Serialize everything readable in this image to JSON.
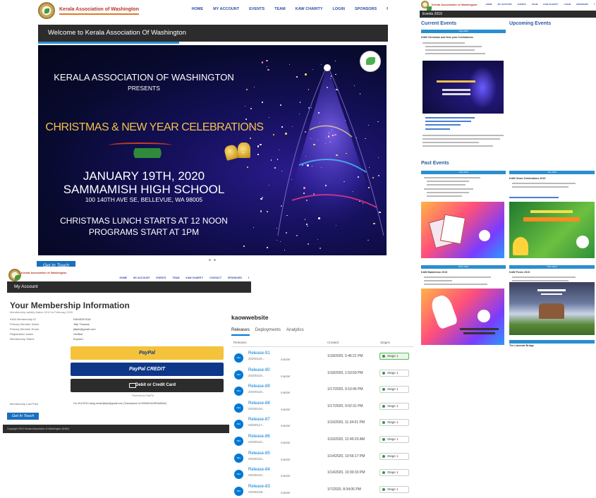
{
  "home": {
    "org_title": "Kerala Association of Washington",
    "menu": [
      "HOME",
      "MY ACCOUNT",
      "EVENTS",
      "TEAM",
      "KAW CHARITY",
      "LOGIN",
      "SPONSORS",
      "f"
    ],
    "welcome": "Welcome to Kerala Association Of Washington",
    "poster": {
      "line1": "KERALA ASSOCIATION OF WASHINGTON",
      "line2": "PRESENTS",
      "line3": "CHRISTMAS & NEW YEAR CELEBRATIONS",
      "line4": "JANUARY 19TH, 2020",
      "line5": "SAMMAMISH HIGH SCHOOL",
      "line6": "100 140TH AVE SE, BELLEVUE, WA 98005",
      "line7": "CHRISTMAS LUNCH STARTS AT 12 NOON",
      "line8": "PROGRAMS START AT 1PM"
    }
  },
  "events": {
    "bar": "Events 2019",
    "current": "Current Events",
    "upcoming": "Upcoming Events",
    "past": "Past Events",
    "current_card": {
      "head": "JAN 2020",
      "title": "KAW Christmas and New year Celebrations"
    },
    "past_cards": [
      {
        "head": "JUN 2019",
        "title": ""
      },
      {
        "head": "JUL 2019",
        "title": "KAW Onam Celebrations 2019"
      },
      {
        "head": "NOV 2019",
        "title": "KAW Badminton 2019"
      },
      {
        "head": "NOV 2019",
        "title": "KAW Picnic 2019"
      }
    ],
    "last_title": "The Lakeside Bridge"
  },
  "account": {
    "get_in_touch": "Get In Touch",
    "menu": [
      "HOME",
      "MY ACCOUNT",
      "EVENTS",
      "TEAM",
      "KAW CHARITY",
      "CONTACT",
      "SPONSORS",
      "f"
    ],
    "bar": "My Account",
    "heading": "Your Membership Information",
    "validity": "Membership validity March 2019 to February 2020",
    "rows": [
      {
        "label": "KAW Membership ID",
        "value": "K8H4D9Y618"
      },
      {
        "label": "Primary Member Name",
        "value": "Jitty Thomas"
      },
      {
        "label": "Primary Member Email",
        "value": "jittyte@gmail.com"
      },
      {
        "label": "Registration status",
        "value": "Verified"
      },
      {
        "label": "Membership Status",
        "value": "Expired"
      }
    ],
    "paypal": "PayPal",
    "paypal_credit": "PayPal CREDIT",
    "debit_card": "Debit or Credit Card",
    "powered": "Powered by PayPal",
    "last_paid_label": "Membership Last Paid",
    "last_paid_value": "On 3/11/2019 using email jittyte@gmail.com (Transaction Id 2HK8910G8P4A89AX)",
    "footer": "Copyright 2019 Kerala Association of Washington (KAW)"
  },
  "releases": {
    "title": "kaowwebsite",
    "tabs": [
      "Releases",
      "Deployments",
      "Analytics"
    ],
    "cols": [
      "Releases",
      "Created",
      "Stages"
    ],
    "items": [
      {
        "name": "Release-91",
        "build": "20200119...",
        "branch": "master",
        "date": "1/18/2020, 5:46:21 PM",
        "stage": "Stage 1",
        "ok": true
      },
      {
        "name": "Release-90",
        "build": "20200119...",
        "branch": "master",
        "date": "1/18/2020, 1:53:59 PM",
        "stage": "Stage 1",
        "ok": false
      },
      {
        "name": "Release-89",
        "build": "20200118...",
        "branch": "master",
        "date": "1/17/2020, 9:10:45 PM",
        "stage": "Stage 1",
        "ok": false
      },
      {
        "name": "Release-88",
        "build": "20200118...",
        "branch": "master",
        "date": "1/17/2020, 9:02:31 PM",
        "stage": "Stage 1",
        "ok": false
      },
      {
        "name": "Release-87",
        "build": "20200117...",
        "branch": "master",
        "date": "1/16/2020, 11:34:01 PM",
        "stage": "Stage 1",
        "ok": false
      },
      {
        "name": "Release-86",
        "build": "20200116...",
        "branch": "master",
        "date": "1/16/2020, 12:40:20 AM",
        "stage": "Stage 1",
        "ok": false
      },
      {
        "name": "Release-85",
        "build": "20200115...",
        "branch": "master",
        "date": "1/14/2020, 10:56:17 PM",
        "stage": "Stage 1",
        "ok": false
      },
      {
        "name": "Release-84",
        "build": "20200115...",
        "branch": "master",
        "date": "1/14/2020, 10:30:33 PM",
        "stage": "Stage 1",
        "ok": false
      },
      {
        "name": "Release-83",
        "build": "20200108...",
        "branch": "master",
        "date": "1/7/2020, 8:34:06 PM",
        "stage": "Stage 1",
        "ok": false
      }
    ]
  },
  "colors": {
    "accent": "#2a8fd0",
    "dark_bar": "#2c2c2c",
    "paypal_gold": "#f5c23b",
    "paypal_blue": "#0e3789",
    "azure": "#0078d4"
  }
}
